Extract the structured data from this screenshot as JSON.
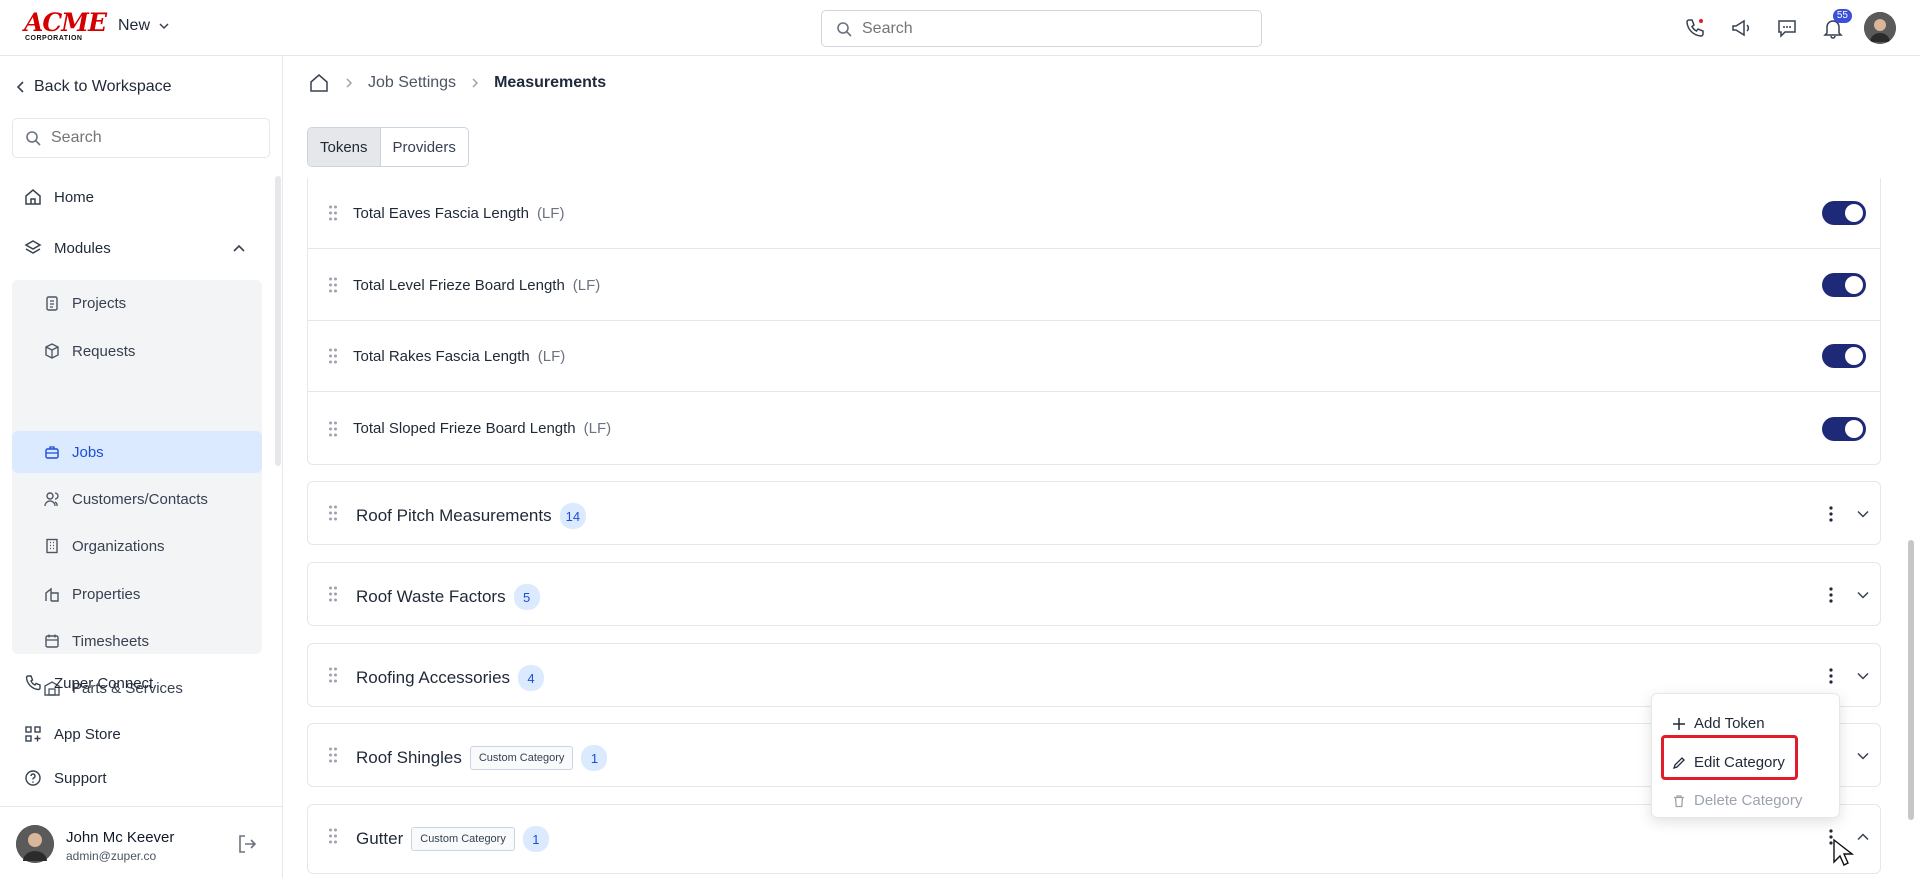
{
  "brand": {
    "line1": "ACME",
    "line2": "CORPORATION"
  },
  "topbar": {
    "new_label": "New",
    "search_placeholder": "Search",
    "notifications_count": "55"
  },
  "sidebar": {
    "back_label": "Back to Workspace",
    "search_placeholder": "Search",
    "home": "Home",
    "modules": "Modules",
    "module_items": [
      "Projects",
      "Requests",
      "Jobs",
      "Customers/Contacts",
      "Organizations",
      "Properties",
      "Timesheets",
      "Parts & Services"
    ],
    "active_module": "Jobs",
    "connect": "Zuper Connect",
    "app_store": "App Store",
    "support": "Support",
    "user": {
      "name": "John Mc Keever",
      "email": "admin@zuper.co"
    }
  },
  "breadcrumb": {
    "level1": "Job Settings",
    "current": "Measurements"
  },
  "tabs": {
    "tokens": "Tokens",
    "providers": "Providers"
  },
  "tokens": [
    {
      "name": "Total Eaves Fascia Length",
      "unit": "(LF)",
      "enabled": true
    },
    {
      "name": "Total Level Frieze Board Length",
      "unit": "(LF)",
      "enabled": true
    },
    {
      "name": "Total Rakes Fascia Length",
      "unit": "(LF)",
      "enabled": true
    },
    {
      "name": "Total Sloped Frieze Board Length",
      "unit": "(LF)",
      "enabled": true
    }
  ],
  "categories": [
    {
      "title": "Roof Pitch Measurements",
      "count": "14",
      "tag": ""
    },
    {
      "title": "Roof Waste Factors",
      "count": "5",
      "tag": ""
    },
    {
      "title": "Roofing Accessories",
      "count": "4",
      "tag": ""
    },
    {
      "title": "Roof Shingles",
      "count": "1",
      "tag": "Custom Category"
    },
    {
      "title": "Gutter",
      "count": "1",
      "tag": "Custom Category"
    }
  ],
  "context_menu": {
    "add_token": "Add Token",
    "edit_category": "Edit Category",
    "delete_category": "Delete Category"
  },
  "colors": {
    "accent": "#1e2a78",
    "highlight": "#e11d2b",
    "active_bg": "#dbeafe"
  }
}
